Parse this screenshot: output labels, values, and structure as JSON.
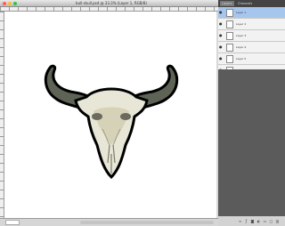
{
  "document": {
    "title": "bull-skull.psd @ 33.3% (Layer 1, RGB/8)",
    "zoom": "",
    "info": ""
  },
  "layers_panel": {
    "tabs": [
      {
        "label": "Layers"
      },
      {
        "label": "Channels"
      }
    ],
    "layers": [
      {
        "name": "Layer 1",
        "fx": "",
        "selected": true
      },
      {
        "name": "Layer 2",
        "fx": ""
      },
      {
        "name": "Layer 3",
        "fx": ""
      },
      {
        "name": "Layer 4",
        "fx": ""
      },
      {
        "name": "Layer 5",
        "fx": ""
      },
      {
        "name": "Layer 6",
        "fx": ""
      }
    ],
    "footer_buttons": [
      "link-icon",
      "fx-icon",
      "mask-icon",
      "adjust-icon",
      "folder-icon",
      "new-layer-icon",
      "trash-icon"
    ]
  },
  "colors": {
    "panel_bg": "#5b5b5b",
    "selected_row": "#a7c6ee",
    "canvas": "#ffffff"
  }
}
